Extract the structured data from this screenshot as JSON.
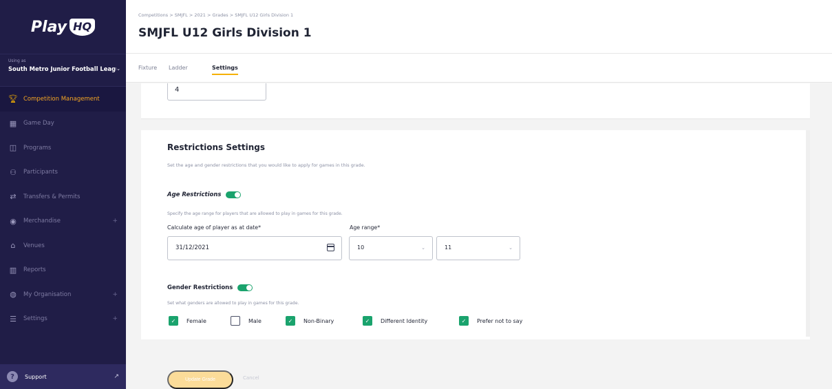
{
  "sidebar": {
    "logo": {
      "text": "Play",
      "badge": "HQ"
    },
    "org": {
      "label": "Using as",
      "name": "South Metro Junior Football League"
    },
    "items": [
      {
        "label": "Competition Management",
        "icon": "trophy-icon",
        "active": true,
        "expandable": false
      },
      {
        "label": "Game Day",
        "icon": "scoreboard-icon",
        "active": false,
        "expandable": false
      },
      {
        "label": "Programs",
        "icon": "book-icon",
        "active": false,
        "expandable": false
      },
      {
        "label": "Participants",
        "icon": "people-icon",
        "active": false,
        "expandable": false
      },
      {
        "label": "Transfers & Permits",
        "icon": "transfer-arrows-icon",
        "active": false,
        "expandable": false
      },
      {
        "label": "Merchandise",
        "icon": "merchandise-icon",
        "active": false,
        "expandable": true
      },
      {
        "label": "Venues",
        "icon": "venue-icon",
        "active": false,
        "expandable": false
      },
      {
        "label": "Reports",
        "icon": "reports-icon",
        "active": false,
        "expandable": false
      },
      {
        "label": "My Organisation",
        "icon": "globe-icon",
        "active": false,
        "expandable": true
      },
      {
        "label": "Settings",
        "icon": "sliders-icon",
        "active": false,
        "expandable": true
      }
    ],
    "support": {
      "label": "Support"
    }
  },
  "header": {
    "breadcrumb": "Competitions > SMJFL > 2021 > Grades > SMJFL U12 Girls Division 1",
    "title": "SMJFL U12 Girls Division 1"
  },
  "tabs": [
    {
      "label": "Fixture",
      "active": false
    },
    {
      "label": "Ladder",
      "active": false
    },
    {
      "label": "Settings",
      "active": true
    }
  ],
  "top_card": {
    "value": "4"
  },
  "restrictions": {
    "title": "Restrictions Settings",
    "description": "Set the age and gender restrictions that you would like to apply for games in this grade.",
    "age": {
      "title": "Age Restrictions",
      "enabled": true,
      "description": "Specify the age range for players that are allowed to play in games for this grade.",
      "date_label": "Calculate age of player as at date*",
      "date_value": "31/12/2021",
      "range_label": "Age range*",
      "range_from": "10",
      "range_to": "11"
    },
    "gender": {
      "title": "Gender Restrictions",
      "enabled": true,
      "description": "Set what genders are allowed to play in games for this grade.",
      "options": [
        {
          "label": "Female",
          "checked": true
        },
        {
          "label": "Male",
          "checked": false
        },
        {
          "label": "Non-Binary",
          "checked": true
        },
        {
          "label": "Different Identity",
          "checked": true
        },
        {
          "label": "Prefer not to say",
          "checked": true
        }
      ]
    }
  },
  "footer": {
    "save_label": "Update Grade",
    "cancel_label": "Cancel"
  },
  "colors": {
    "sidebar_bg": "#201d47",
    "accent": "#f5b000",
    "toggle_on": "#1aa36d"
  }
}
